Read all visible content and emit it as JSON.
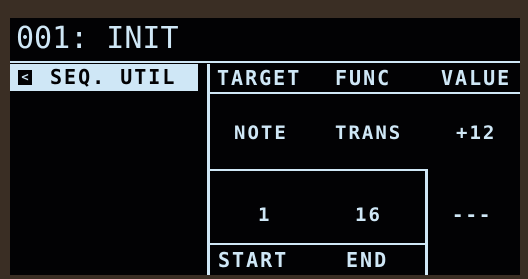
{
  "header": {
    "title": "001: INIT"
  },
  "nav": {
    "back_icon": "back-arrow-icon",
    "back_glyph": "<",
    "selected_page": "SEQ. UTIL"
  },
  "columns": {
    "target": "TARGET",
    "func": "FUNC",
    "value": "VALUE"
  },
  "row1": {
    "target": "NOTE",
    "func": "TRANS",
    "value": "+12"
  },
  "row2": {
    "start": "1",
    "end": "16",
    "value": "---"
  },
  "footer": {
    "start_label": "START",
    "end_label": "END"
  },
  "colors": {
    "lcd_foreground": "#cfe7f6",
    "lcd_background": "#020204",
    "bezel": "#3a2e24"
  }
}
